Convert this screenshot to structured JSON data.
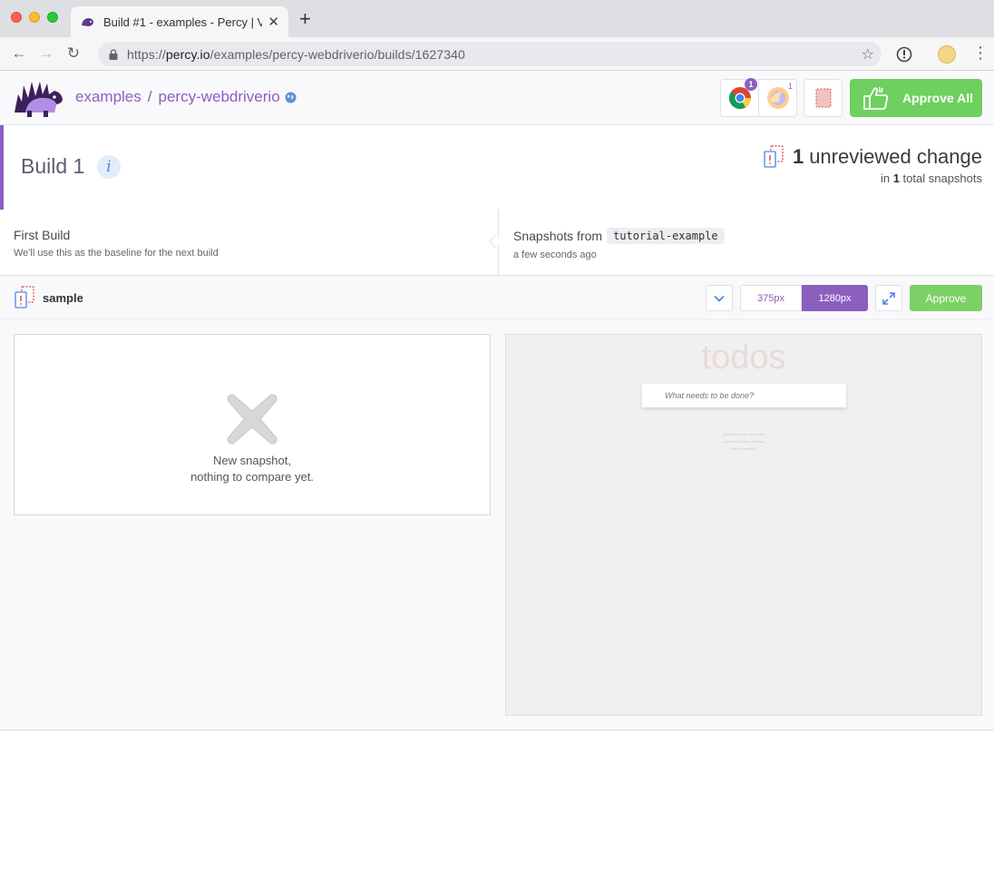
{
  "browser": {
    "tab_title": "Build #1 - examples - Percy | V",
    "new_tab": "+",
    "url_scheme": "https://",
    "url_domain": "percy.io",
    "url_path": "/examples/percy-webdriverio/builds/1627340"
  },
  "header": {
    "org": "examples",
    "separator": "/",
    "project": "percy-webdriverio",
    "chrome_count": "1",
    "firefox_count": "1",
    "approve_all_label": "Approve All"
  },
  "build": {
    "title": "Build 1",
    "info": "i",
    "unreviewed_count": "1",
    "unreviewed_label": "unreviewed change",
    "total_prefix": "in",
    "total_count": "1",
    "total_suffix": "total snapshots"
  },
  "meta": {
    "base_title": "First Build",
    "base_sub": "We'll use this as the baseline for the next build",
    "head_title": "Snapshots from",
    "head_branch": "tutorial-example",
    "head_time": "a few seconds ago"
  },
  "snapshot": {
    "name": "sample",
    "width_small": "375px",
    "width_large": "1280px",
    "approve_label": "Approve",
    "base_message_line1": "New snapshot,",
    "base_message_line2": "nothing to compare yet.",
    "preview_title": "todos",
    "preview_placeholder": "What needs to be done?",
    "preview_footer_1": "Double-click to edit a todo",
    "preview_footer_2": "Created by Oscar Godson",
    "preview_footer_3": "Part of TodoMVC"
  },
  "colors": {
    "brand_purple": "#8c5fbf",
    "approve_green": "#6ed05e"
  }
}
